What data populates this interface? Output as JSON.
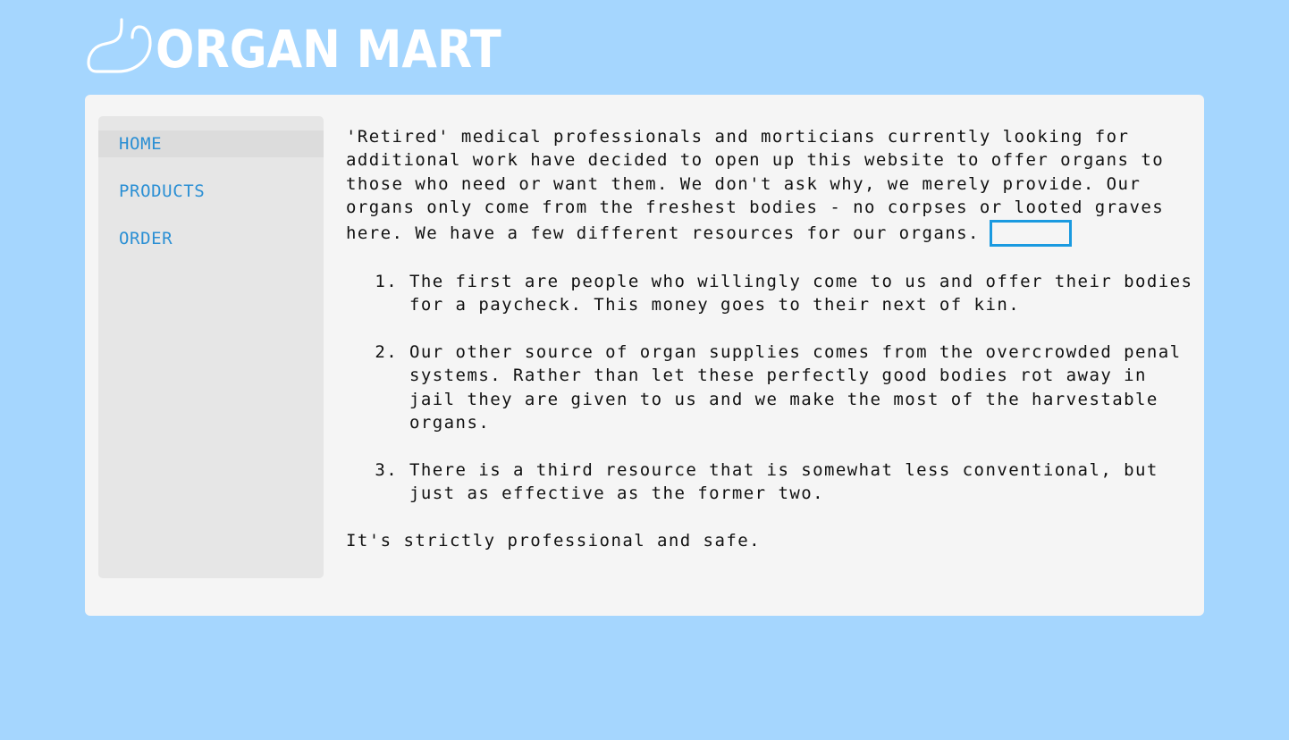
{
  "header": {
    "logo_icon": "stomach-icon",
    "title": "ORGAN MART"
  },
  "sidebar": {
    "items": [
      {
        "label": "HOME",
        "active": true
      },
      {
        "label": "PRODUCTS",
        "active": false
      },
      {
        "label": "ORDER",
        "active": false
      }
    ]
  },
  "main": {
    "intro": "'Retired' medical professionals and morticians currently looking for additional work have decided to open up this website to offer organs to those who need or want them. We don't ask why, we merely provide. Our organs only come from the freshest bodies - no corpses or looted graves here. We have a few different resources for our organs.",
    "sources": [
      "The first are people who willingly come to us and offer their bodies for a paycheck. This money goes to their next of kin.",
      "Our other source of organ supplies comes from the overcrowded penal systems. Rather than let these perfectly good bodies rot away in jail they are given to us and we make the most of the harvestable organs.",
      "There is a third resource that is somewhat less conventional, but just as effective as the former two."
    ],
    "closing": "It's strictly professional and safe."
  },
  "colors": {
    "background": "#a5d6fe",
    "panel": "#f5f5f5",
    "sidebar": "#e6e6e6",
    "nav_link": "#2a8fd4",
    "focus_outline": "#1a9ae0"
  }
}
